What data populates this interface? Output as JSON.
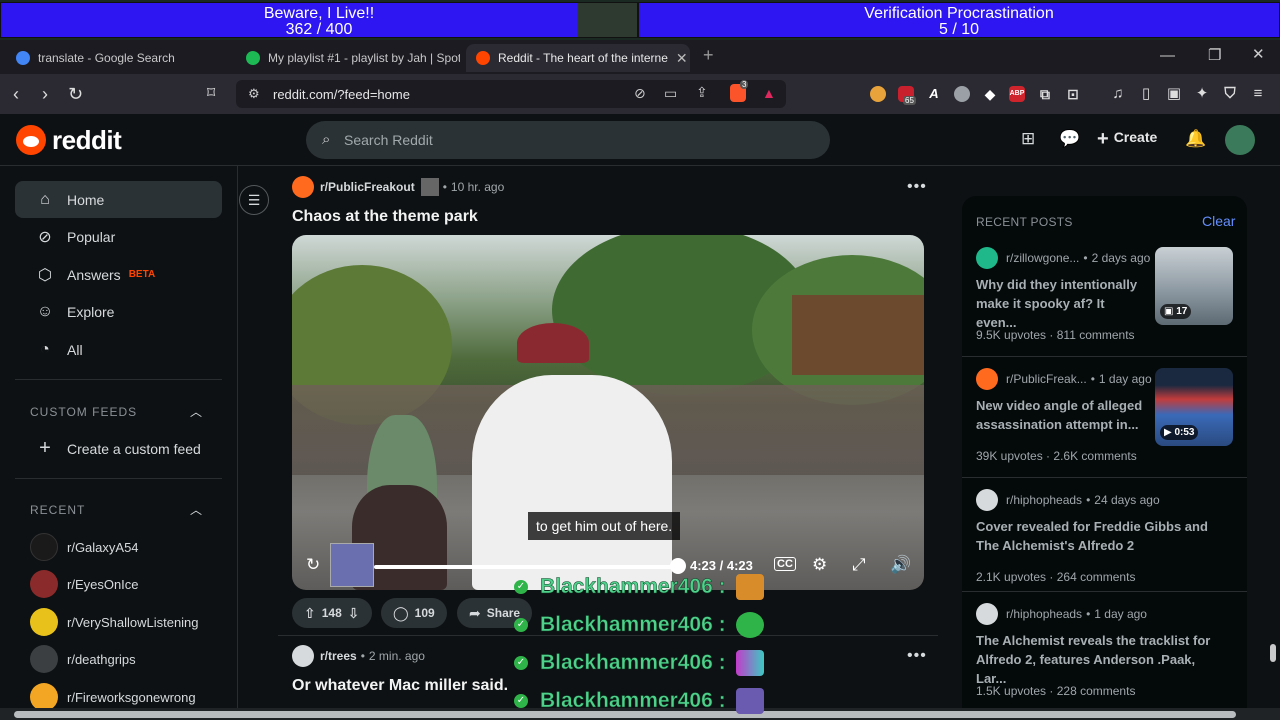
{
  "overlay": {
    "left": {
      "title": "Beware, I Live!!",
      "count": "362  / 400",
      "progress": 0.905
    },
    "right": {
      "title": "Verification Procrastination",
      "count": "5  / 10",
      "progress": 1.0
    }
  },
  "browser": {
    "tabs": [
      {
        "label": "translate - Google Search",
        "favicon_color": "#4285f4"
      },
      {
        "label": "My playlist #1 - playlist by Jah | Spoti",
        "favicon_color": "#1db954"
      },
      {
        "label": "Reddit - The heart of the interne",
        "favicon_color": "#ff4500",
        "active": true
      }
    ],
    "new_tab": "+",
    "url": "reddit.com/?feed=home",
    "ext_badges": {
      "shield": "3",
      "counter": "65"
    }
  },
  "header": {
    "logo_text": "reddit",
    "search_placeholder": "Search Reddit",
    "create_label": "Create"
  },
  "sidebar": {
    "nav": [
      {
        "label": "Home",
        "icon": "home-icon",
        "active": true
      },
      {
        "label": "Popular",
        "icon": "popular-icon"
      },
      {
        "label": "Answers",
        "icon": "answers-icon",
        "badge": "BETA"
      },
      {
        "label": "Explore",
        "icon": "explore-icon"
      },
      {
        "label": "All",
        "icon": "all-icon"
      }
    ],
    "custom_feeds_header": "CUSTOM FEEDS",
    "create_feed_label": "Create a custom feed",
    "recent_header": "RECENT",
    "recent": [
      {
        "label": "r/GalaxyA54",
        "color": "#1a1a1a"
      },
      {
        "label": "r/EyesOnIce",
        "color": "#8a2a2a"
      },
      {
        "label": "r/VeryShallowListening",
        "color": "#e8c21a"
      },
      {
        "label": "r/deathgrips",
        "color": "#3b3f42"
      },
      {
        "label": "r/Fireworksgonewrong",
        "color": "#f2a623"
      }
    ]
  },
  "feed": {
    "post1": {
      "subreddit": "r/PublicFreakout",
      "time": "10 hr. ago",
      "title": "Chaos at the theme park",
      "caption": "to get him out of here.",
      "video_time": "4:23 / 4:23",
      "votes": "148",
      "comments": "109",
      "share": "Share"
    },
    "post2": {
      "subreddit": "r/trees",
      "time": "2 min. ago",
      "title": "Or whatever Mac miller said."
    }
  },
  "chat": [
    {
      "name": "Blackhammer406 :",
      "emote_color": "#d98c2a"
    },
    {
      "name": "Blackhammer406 :",
      "emote_color": "#2fb44a"
    },
    {
      "name": "Blackhammer406 :",
      "emote_color": "#c23cc9"
    },
    {
      "name": "Blackhammer406 :",
      "emote_color": "#6a5ab0"
    }
  ],
  "recent_posts": {
    "header": "RECENT POSTS",
    "clear": "Clear",
    "items": [
      {
        "subreddit": "r/zillowgone...",
        "time": "2 days ago",
        "title": "Why did they intentionally make it spooky af? It even...",
        "upvotes": "9.5K upvotes",
        "comments": "811 comments",
        "thumb_badge": "17",
        "thumb_color": "#8e9aa3",
        "sub_color": "#1fb88a"
      },
      {
        "subreddit": "r/PublicFreak...",
        "time": "1 day ago",
        "title": "New video angle of alleged assassination attempt in...",
        "upvotes": "39K upvotes",
        "comments": "2.6K comments",
        "thumb_badge": "0:53",
        "thumb_color": "#3a6ab8",
        "sub_color": "#ff6a1f"
      },
      {
        "subreddit": "r/hiphopheads",
        "time": "24 days ago",
        "title": "Cover revealed for Freddie Gibbs and The Alchemist's Alfredo 2",
        "upvotes": "2.1K upvotes",
        "comments": "264 comments",
        "sub_color": "#d7dadc"
      },
      {
        "subreddit": "r/hiphopheads",
        "time": "1 day ago",
        "title": "The Alchemist reveals the tracklist for Alfredo 2, features Anderson .Paak, Lar...",
        "upvotes": "1.5K upvotes",
        "comments": "228 comments",
        "sub_color": "#d7dadc"
      }
    ]
  },
  "colors": {
    "accent": "#ff4500",
    "link": "#648efc",
    "chat_name": "#4fd18b"
  }
}
